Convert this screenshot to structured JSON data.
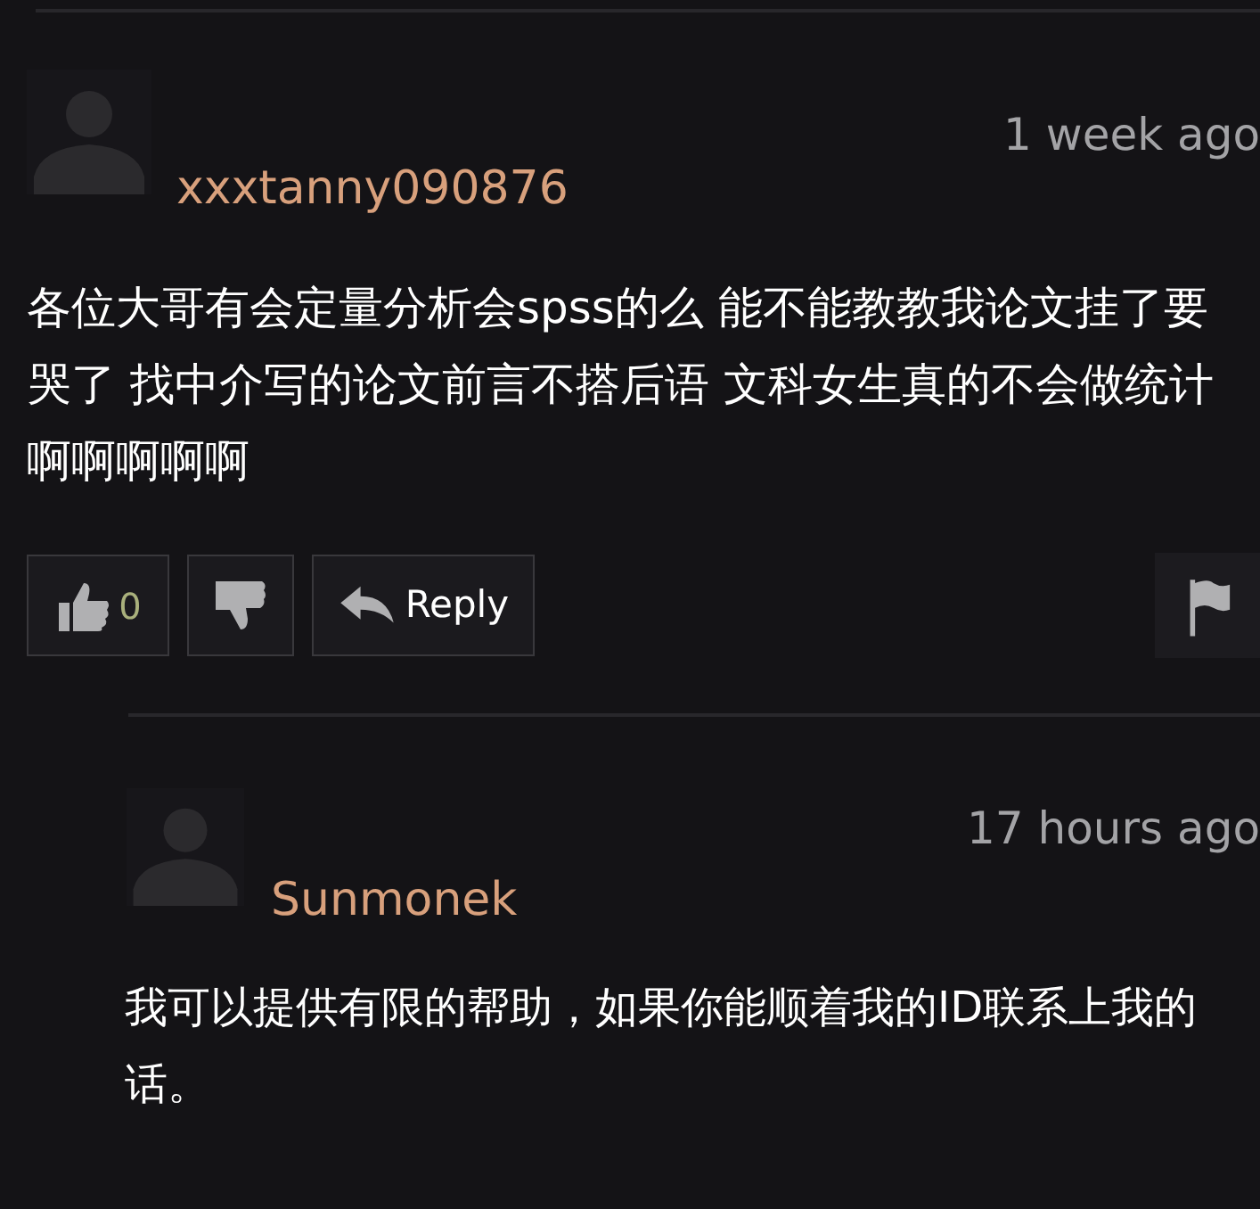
{
  "comments": [
    {
      "username": "xxxtanny090876",
      "time": "1 week ago",
      "body": "各位大哥有会定量分析会spss的么 能不能教教我论文挂了要哭了 找中介写的论文前言不搭后语 文科女生真的不会做统计啊啊啊啊啊",
      "likes": "0",
      "reply_label": "Reply",
      "children": [
        {
          "username": "Sunmonek",
          "time": "17 hours ago",
          "body": "我可以提供有限的帮助，如果你能顺着我的ID联系上我的话。"
        }
      ]
    }
  ]
}
